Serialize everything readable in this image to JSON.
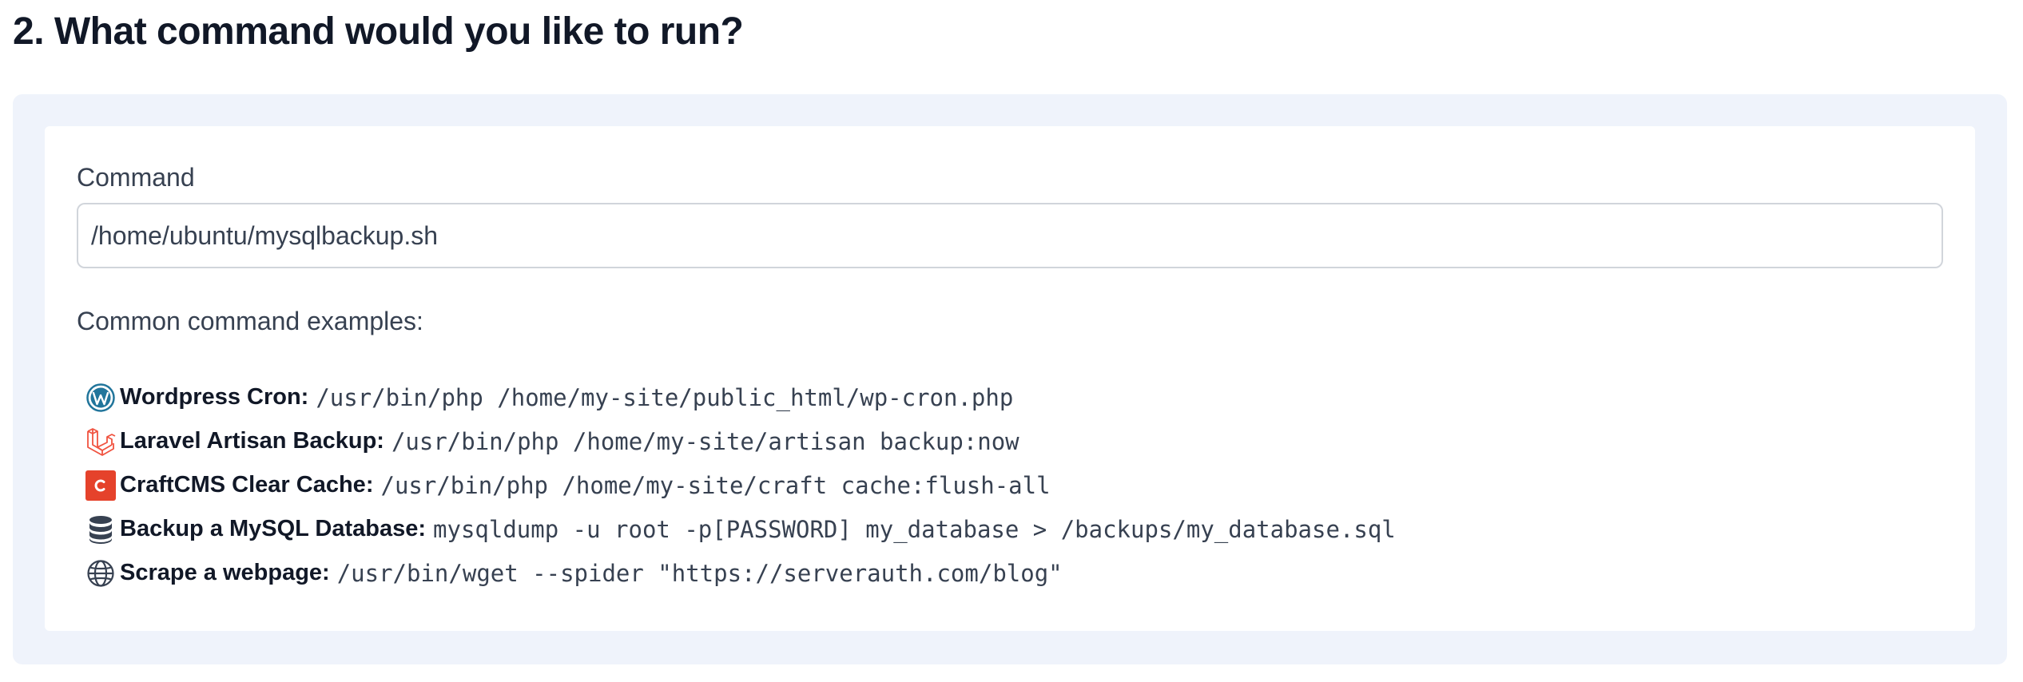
{
  "section": {
    "title": "2. What command would you like to run?"
  },
  "command_field": {
    "label": "Command",
    "value": "/home/ubuntu/mysqlbackup.sh"
  },
  "examples": {
    "heading": "Common command examples:",
    "items": [
      {
        "icon": "wordpress-icon",
        "name": "Wordpress Cron:",
        "command": "/usr/bin/php /home/my-site/public_html/wp-cron.php"
      },
      {
        "icon": "laravel-icon",
        "name": "Laravel Artisan Backup:",
        "command": "/usr/bin/php /home/my-site/artisan backup:now"
      },
      {
        "icon": "craftcms-icon",
        "name": "CraftCMS Clear Cache:",
        "command": "/usr/bin/php /home/my-site/craft cache:flush-all"
      },
      {
        "icon": "database-icon",
        "name": "Backup a MySQL Database:",
        "command": "mysqldump -u root -p[PASSWORD] my_database > /backups/my_database.sql"
      },
      {
        "icon": "globe-icon",
        "name": "Scrape a webpage:",
        "command": "/usr/bin/wget --spider \"https://serverauth.com/blog\""
      }
    ]
  },
  "colors": {
    "panel_background": "#eff3fb",
    "wordpress": "#21759b",
    "laravel": "#f05340",
    "craftcms": "#e5422b",
    "heading_text": "#111827"
  }
}
